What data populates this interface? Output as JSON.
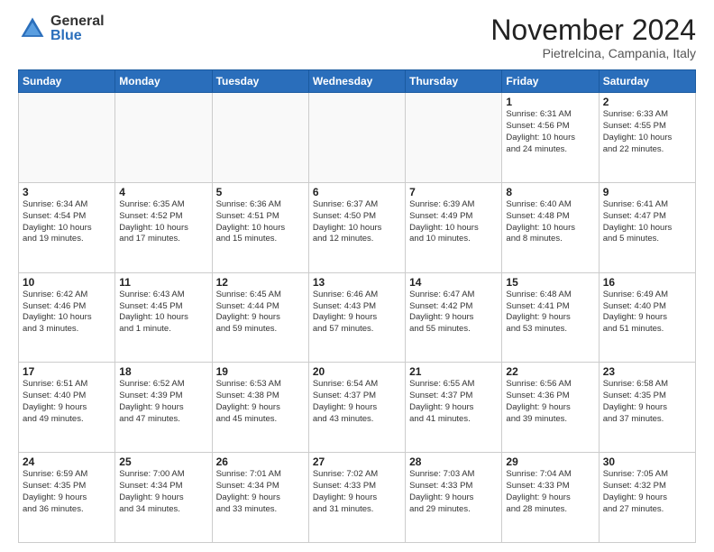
{
  "header": {
    "logo_general": "General",
    "logo_blue": "Blue",
    "title": "November 2024",
    "location": "Pietrelcina, Campania, Italy"
  },
  "days_of_week": [
    "Sunday",
    "Monday",
    "Tuesday",
    "Wednesday",
    "Thursday",
    "Friday",
    "Saturday"
  ],
  "weeks": [
    [
      {
        "day": "",
        "info": ""
      },
      {
        "day": "",
        "info": ""
      },
      {
        "day": "",
        "info": ""
      },
      {
        "day": "",
        "info": ""
      },
      {
        "day": "",
        "info": ""
      },
      {
        "day": "1",
        "info": "Sunrise: 6:31 AM\nSunset: 4:56 PM\nDaylight: 10 hours\nand 24 minutes."
      },
      {
        "day": "2",
        "info": "Sunrise: 6:33 AM\nSunset: 4:55 PM\nDaylight: 10 hours\nand 22 minutes."
      }
    ],
    [
      {
        "day": "3",
        "info": "Sunrise: 6:34 AM\nSunset: 4:54 PM\nDaylight: 10 hours\nand 19 minutes."
      },
      {
        "day": "4",
        "info": "Sunrise: 6:35 AM\nSunset: 4:52 PM\nDaylight: 10 hours\nand 17 minutes."
      },
      {
        "day": "5",
        "info": "Sunrise: 6:36 AM\nSunset: 4:51 PM\nDaylight: 10 hours\nand 15 minutes."
      },
      {
        "day": "6",
        "info": "Sunrise: 6:37 AM\nSunset: 4:50 PM\nDaylight: 10 hours\nand 12 minutes."
      },
      {
        "day": "7",
        "info": "Sunrise: 6:39 AM\nSunset: 4:49 PM\nDaylight: 10 hours\nand 10 minutes."
      },
      {
        "day": "8",
        "info": "Sunrise: 6:40 AM\nSunset: 4:48 PM\nDaylight: 10 hours\nand 8 minutes."
      },
      {
        "day": "9",
        "info": "Sunrise: 6:41 AM\nSunset: 4:47 PM\nDaylight: 10 hours\nand 5 minutes."
      }
    ],
    [
      {
        "day": "10",
        "info": "Sunrise: 6:42 AM\nSunset: 4:46 PM\nDaylight: 10 hours\nand 3 minutes."
      },
      {
        "day": "11",
        "info": "Sunrise: 6:43 AM\nSunset: 4:45 PM\nDaylight: 10 hours\nand 1 minute."
      },
      {
        "day": "12",
        "info": "Sunrise: 6:45 AM\nSunset: 4:44 PM\nDaylight: 9 hours\nand 59 minutes."
      },
      {
        "day": "13",
        "info": "Sunrise: 6:46 AM\nSunset: 4:43 PM\nDaylight: 9 hours\nand 57 minutes."
      },
      {
        "day": "14",
        "info": "Sunrise: 6:47 AM\nSunset: 4:42 PM\nDaylight: 9 hours\nand 55 minutes."
      },
      {
        "day": "15",
        "info": "Sunrise: 6:48 AM\nSunset: 4:41 PM\nDaylight: 9 hours\nand 53 minutes."
      },
      {
        "day": "16",
        "info": "Sunrise: 6:49 AM\nSunset: 4:40 PM\nDaylight: 9 hours\nand 51 minutes."
      }
    ],
    [
      {
        "day": "17",
        "info": "Sunrise: 6:51 AM\nSunset: 4:40 PM\nDaylight: 9 hours\nand 49 minutes."
      },
      {
        "day": "18",
        "info": "Sunrise: 6:52 AM\nSunset: 4:39 PM\nDaylight: 9 hours\nand 47 minutes."
      },
      {
        "day": "19",
        "info": "Sunrise: 6:53 AM\nSunset: 4:38 PM\nDaylight: 9 hours\nand 45 minutes."
      },
      {
        "day": "20",
        "info": "Sunrise: 6:54 AM\nSunset: 4:37 PM\nDaylight: 9 hours\nand 43 minutes."
      },
      {
        "day": "21",
        "info": "Sunrise: 6:55 AM\nSunset: 4:37 PM\nDaylight: 9 hours\nand 41 minutes."
      },
      {
        "day": "22",
        "info": "Sunrise: 6:56 AM\nSunset: 4:36 PM\nDaylight: 9 hours\nand 39 minutes."
      },
      {
        "day": "23",
        "info": "Sunrise: 6:58 AM\nSunset: 4:35 PM\nDaylight: 9 hours\nand 37 minutes."
      }
    ],
    [
      {
        "day": "24",
        "info": "Sunrise: 6:59 AM\nSunset: 4:35 PM\nDaylight: 9 hours\nand 36 minutes."
      },
      {
        "day": "25",
        "info": "Sunrise: 7:00 AM\nSunset: 4:34 PM\nDaylight: 9 hours\nand 34 minutes."
      },
      {
        "day": "26",
        "info": "Sunrise: 7:01 AM\nSunset: 4:34 PM\nDaylight: 9 hours\nand 33 minutes."
      },
      {
        "day": "27",
        "info": "Sunrise: 7:02 AM\nSunset: 4:33 PM\nDaylight: 9 hours\nand 31 minutes."
      },
      {
        "day": "28",
        "info": "Sunrise: 7:03 AM\nSunset: 4:33 PM\nDaylight: 9 hours\nand 29 minutes."
      },
      {
        "day": "29",
        "info": "Sunrise: 7:04 AM\nSunset: 4:33 PM\nDaylight: 9 hours\nand 28 minutes."
      },
      {
        "day": "30",
        "info": "Sunrise: 7:05 AM\nSunset: 4:32 PM\nDaylight: 9 hours\nand 27 minutes."
      }
    ]
  ]
}
